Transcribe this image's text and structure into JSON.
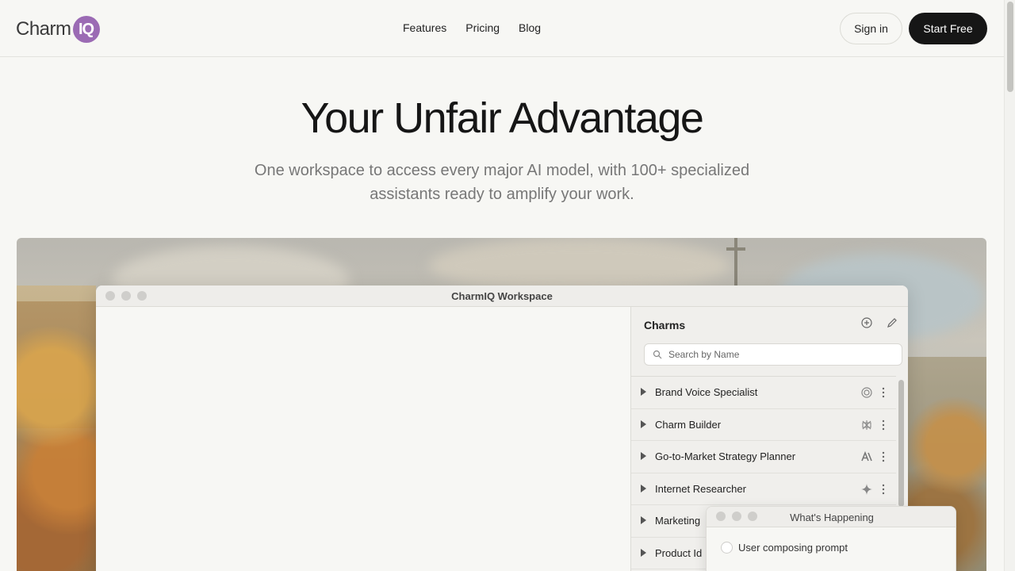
{
  "header": {
    "logo_text": "Charm",
    "logo_badge": "IQ",
    "nav": [
      "Features",
      "Pricing",
      "Blog"
    ],
    "sign_in": "Sign in",
    "start_free": "Start Free"
  },
  "hero": {
    "title": "Your Unfair Advantage",
    "subtitle": "One workspace to access every major AI model, with 100+ specialized assistants ready to amplify your work."
  },
  "window": {
    "title": "CharmIQ Workspace",
    "charms": {
      "title": "Charms",
      "search_placeholder": "Search by Name",
      "items": [
        {
          "label": "Brand Voice Specialist",
          "model_icon": "openai-icon"
        },
        {
          "label": "Charm Builder",
          "model_icon": "perplexity-icon"
        },
        {
          "label": "Go-to-Market Strategy Planner",
          "model_icon": "anthropic-icon"
        },
        {
          "label": "Internet Researcher",
          "model_icon": "gemini-sparkle-icon"
        },
        {
          "label": "Marketing",
          "model_icon": ""
        },
        {
          "label": "Product Id",
          "model_icon": ""
        }
      ]
    }
  },
  "popup": {
    "title": "What's Happening",
    "status": "User composing prompt"
  },
  "colors": {
    "accent": "#9b6bb4",
    "primary_button": "#161616",
    "background": "#f7f7f4"
  }
}
